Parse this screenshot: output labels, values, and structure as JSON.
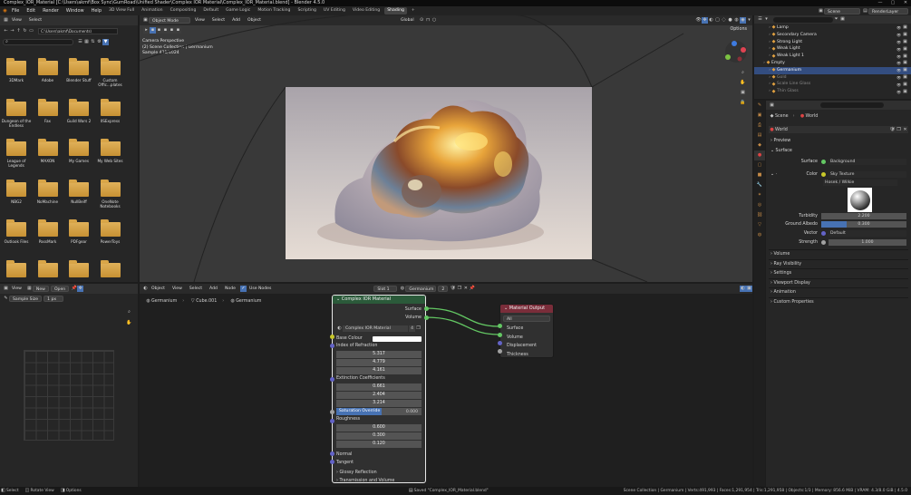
{
  "window": {
    "title": "Complex_IOR_Material [C:\\Users\\akmf\\Box Sync\\GumRoad\\Unified Shader\\Complex IOR Material\\Complex_IOR_Material.blend] - Blender 4.5.0",
    "minimize": "—",
    "maximize": "▢",
    "close": "✕"
  },
  "menubar": {
    "items": [
      "File",
      "Edit",
      "Render",
      "Window",
      "Help"
    ],
    "tabs": [
      "3D View Full",
      "Animation",
      "Compositing",
      "Default",
      "Game Logic",
      "Motion Tracking",
      "Scripting",
      "UV Editing",
      "Video Editing",
      "Shading"
    ],
    "active_tab": "Shading",
    "add_tab": "+",
    "scene_label": "Scene",
    "view_layer_label": "RenderLayer"
  },
  "file_browser": {
    "header": [
      "View",
      "Select"
    ],
    "path": "C:\\Users\\akmf\\Documents\\",
    "search_placeholder": "",
    "folders": [
      "3DMark",
      "Adobe",
      "Blender Stuff",
      "Custom Offic...plates",
      "Dungeon of the Endless",
      "Fax",
      "Guild Wars 2",
      "IISExpress",
      "League of Legends",
      "MAXON",
      "My Games",
      "My Web Sites",
      "NBG2",
      "NoMachine",
      "NullBeiff",
      "OneNote Notebooks",
      "Outlook Files",
      "PassMark",
      "PDFgear",
      "PowerToys",
      "",
      "",
      "",
      ""
    ]
  },
  "viewport": {
    "mode": "Object Mode",
    "menu": [
      "View",
      "Select",
      "Add",
      "Object"
    ],
    "transform": "Global",
    "options": "Options",
    "info_line1": "Camera Perspective",
    "info_line2": "(2) Scene Collection | Germanium",
    "info_line3": "Sample 421/1024"
  },
  "uv_editor": {
    "header": [
      "View"
    ],
    "new_label": "New",
    "open_label": "Open",
    "sample_size_label": "Sample Size",
    "sample_size_value": "1 px"
  },
  "node_editor": {
    "header": [
      "Object",
      "View",
      "Select",
      "Add",
      "Node"
    ],
    "use_nodes": "Use Nodes",
    "slot": "Slot 1",
    "material": "Germanium",
    "users": "2",
    "breadcrumb": [
      "Germanium",
      "Cube.001",
      "Germanium"
    ],
    "group_node": {
      "title": "Complex IOR Material",
      "outputs": [
        "Surface",
        "Volume"
      ],
      "group_name": "Complex IOR Material",
      "group_users": "4",
      "base_colour": "Base Colour",
      "ior_label": "Index of Refraction",
      "ior_values": [
        "5.317",
        "4.779",
        "4.161"
      ],
      "ext_label": "Extinction Coefficients",
      "ext_values": [
        "0.661",
        "2.404",
        "3.214"
      ],
      "saturation_label": "Saturation Override",
      "saturation_value": "0.000",
      "roughness_label": "Roughness",
      "roughness_values": [
        "0.600",
        "0.300",
        "0.120"
      ],
      "normal": "Normal",
      "tangent": "Tangent",
      "glossy": "Glossy Reflection",
      "transmission": "Transmission and Volume"
    },
    "output_node": {
      "title": "Material Output",
      "target": "All",
      "inputs": [
        "Surface",
        "Volume",
        "Displacement",
        "Thickness"
      ]
    }
  },
  "outliner": {
    "items": [
      {
        "label": "Lamp",
        "color": "#e0e0e0"
      },
      {
        "label": "Secondary Camera",
        "color": "#e0e0e0"
      },
      {
        "label": "Strong Light",
        "color": "#e0e0e0"
      },
      {
        "label": "Weak Light",
        "color": "#e0e0e0"
      },
      {
        "label": "Weak Light 1",
        "color": "#e0e0e0"
      },
      {
        "label": "Empty",
        "color": "#e0e0e0"
      },
      {
        "label": "Germanium",
        "color": "#ffffff"
      },
      {
        "label": "Gold",
        "color": "#8a8a8a"
      },
      {
        "label": "Scale Line Glass",
        "color": "#8a8a8a"
      },
      {
        "label": "Thin Glass",
        "color": "#8a8a8a"
      }
    ],
    "selected_index": 6
  },
  "properties": {
    "breadcrumb": [
      "Scene",
      "World"
    ],
    "world_name": "World",
    "sections": [
      "Preview",
      "Surface"
    ],
    "surface_label": "Surface",
    "surface_value": "Background",
    "color_label": "Color",
    "color_value": "Sky Texture",
    "sky_type": "Hosek / Wilkie",
    "turbidity_label": "Turbidity",
    "turbidity_value": "2.200",
    "albedo_label": "Ground Albedo",
    "albedo_value": "0.300",
    "albedo_fraction": 0.3,
    "vector_label": "Vector",
    "vector_value": "Default",
    "strength_label": "Strength",
    "strength_value": "1.000",
    "collapsed": [
      "Volume",
      "Ray Visibility",
      "Settings",
      "Viewport Display",
      "Animation",
      "Custom Properties"
    ]
  },
  "status": {
    "select": "Select",
    "rotate": "Rotate View",
    "options": "Options",
    "saved": "Saved \"Complex_IOR_Material.blend\"",
    "stats": "Scene Collection | Germanium | Verts:491,993 | Faces:1,291,954 | Tris:1,291,958 | Objects:1/3 | Memory: 856.6 MiB | VRAM: 4.3/8.0 GiB | 4.5.0"
  },
  "colors": {
    "accent_blue": "#4772b3",
    "selection": "#334d80",
    "node_group_header": "#2b5a3a",
    "output_header": "#7a2d3a",
    "socket_green": "#63c763",
    "socket_yellow": "#c7c729",
    "socket_gray": "#a1a1a1",
    "socket_purple": "#6363c7"
  }
}
